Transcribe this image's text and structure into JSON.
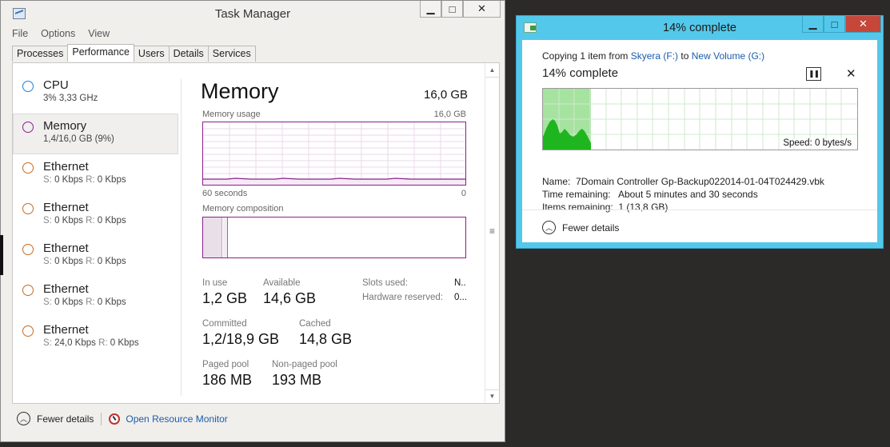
{
  "task_manager": {
    "title": "Task Manager",
    "window_buttons": [
      "▁",
      "□",
      "✕"
    ],
    "menu": [
      "File",
      "Options",
      "View"
    ],
    "tabs": [
      "Processes",
      "Performance",
      "Users",
      "Details",
      "Services"
    ],
    "active_tab": "Performance",
    "sidebar": [
      {
        "name": "CPU",
        "sub": "3%  3,33 GHz",
        "color": "#1f7fd6"
      },
      {
        "name": "Memory",
        "sub": "1,4/16,0 GB (9%)",
        "color": "#8b1f8b"
      },
      {
        "name": "Ethernet",
        "s_label": "S:",
        "s_value": "0 Kbps",
        "r_label": "R:",
        "r_value": "0 Kbps",
        "color": "#c86a1e"
      },
      {
        "name": "Ethernet",
        "s_label": "S:",
        "s_value": "0 Kbps",
        "r_label": "R:",
        "r_value": "0 Kbps",
        "color": "#c86a1e"
      },
      {
        "name": "Ethernet",
        "s_label": "S:",
        "s_value": "0 Kbps",
        "r_label": "R:",
        "r_value": "0 Kbps",
        "color": "#c86a1e"
      },
      {
        "name": "Ethernet",
        "s_label": "S:",
        "s_value": "0 Kbps",
        "r_label": "R:",
        "r_value": "0 Kbps",
        "color": "#c86a1e"
      },
      {
        "name": "Ethernet",
        "s_label": "S:",
        "s_value": "24,0 Kbps",
        "r_label": "R:",
        "r_value": "0 Kbps",
        "color": "#c86a1e"
      }
    ],
    "memory": {
      "title": "Memory",
      "total": "16,0 GB",
      "usage_label": "Memory usage",
      "usage_max": "16,0 GB",
      "time_left": "60 seconds",
      "time_right": "0",
      "composition_label": "Memory composition",
      "in_use_label": "In use",
      "in_use": "1,2 GB",
      "available_label": "Available",
      "available": "14,6 GB",
      "slots_label": "Slots used:",
      "slots": "N..",
      "hw_reserved_label": "Hardware reserved:",
      "hw_reserved": "0...",
      "committed_label": "Committed",
      "committed": "1,2/18,9 GB",
      "cached_label": "Cached",
      "cached": "14,8 GB",
      "paged_label": "Paged pool",
      "paged": "186 MB",
      "nonpaged_label": "Non-paged pool",
      "nonpaged": "193 MB",
      "accent": "#8b1f8b"
    },
    "footer": {
      "fewer_details": "Fewer details",
      "resource_monitor": "Open Resource Monitor"
    }
  },
  "copy_dialog": {
    "title": "14% complete",
    "window_buttons": [
      "▁",
      "□",
      "✕"
    ],
    "line_prefix": "Copying 1 item from",
    "source": "Skyera (F:)",
    "line_mid": "to",
    "destination": "New Volume (G:)",
    "percent_text": "14% complete",
    "progress": 0.14,
    "speed": "Speed: 0 bytes/s",
    "name_label": "Name:",
    "name_value": "7Domain Controller Gp-Backup022014-01-04T024429.vbk",
    "time_label": "Time remaining:",
    "time_value": "About 5 minutes and 30 seconds",
    "items_label": "Items remaining:",
    "items_value": "1 (13,8 GB)",
    "fewer_details": "Fewer details",
    "accent": "#54c8ea",
    "graph_color": "#1fb51f"
  }
}
